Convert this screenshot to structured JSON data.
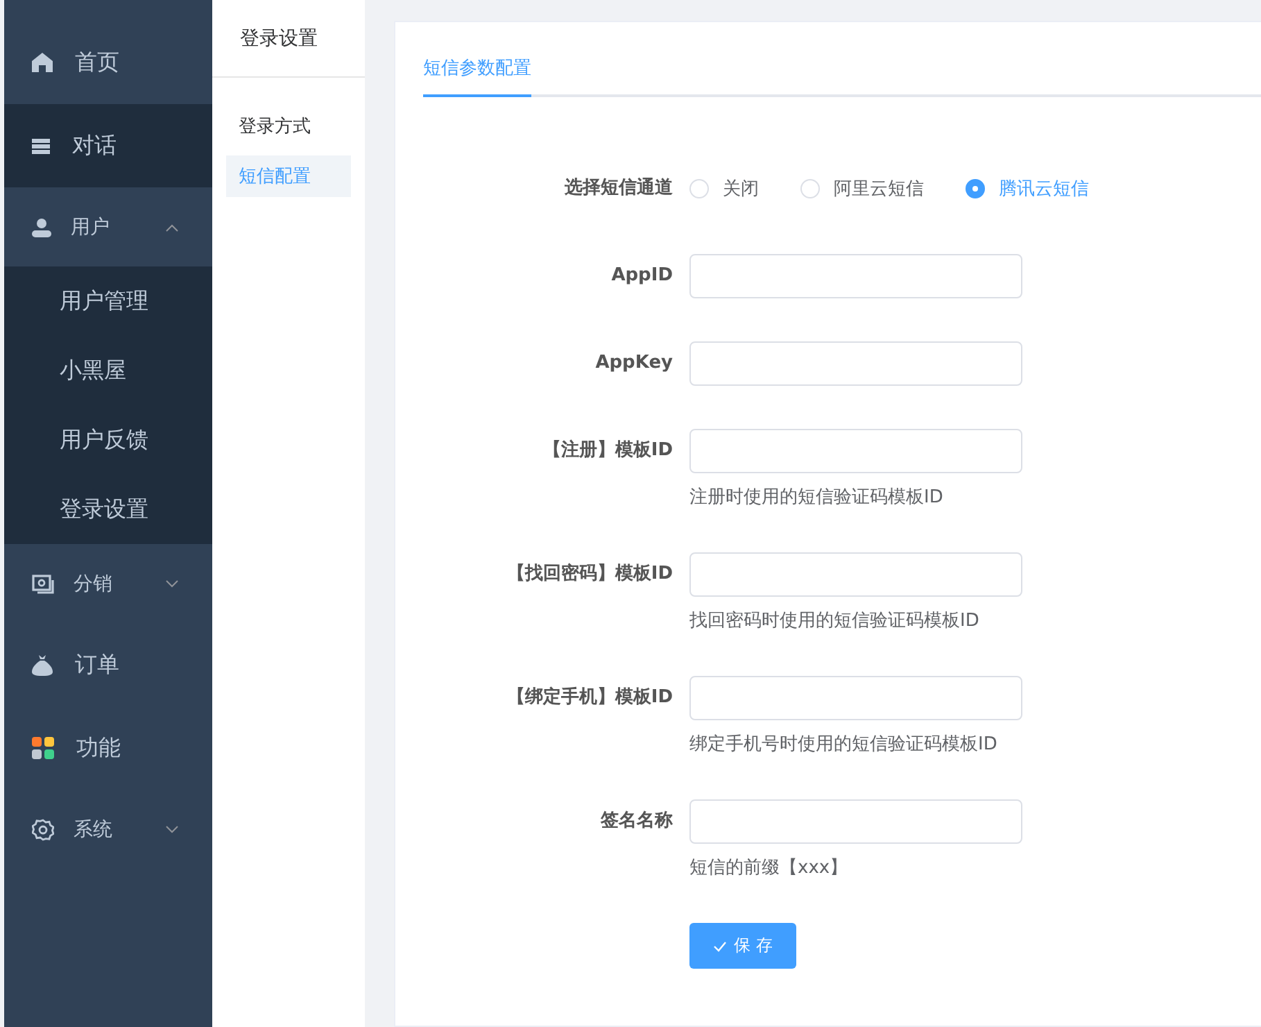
{
  "sidebar": {
    "items": [
      {
        "label": "首页",
        "hover": false
      },
      {
        "label": "对话",
        "hover": true
      },
      {
        "label": "用户",
        "hover": false,
        "expanded": true,
        "children": [
          {
            "label": "用户管理"
          },
          {
            "label": "小黑屋"
          },
          {
            "label": "用户反馈"
          },
          {
            "label": "登录设置"
          }
        ]
      },
      {
        "label": "分销",
        "hover": false,
        "expanded": false
      },
      {
        "label": "订单",
        "hover": false
      },
      {
        "label": "功能",
        "hover": false
      },
      {
        "label": "系统",
        "hover": false,
        "expanded": false
      }
    ]
  },
  "subnav": {
    "title": "登录设置",
    "items": [
      {
        "label": "登录方式",
        "selected": false
      },
      {
        "label": "短信配置",
        "selected": true
      }
    ]
  },
  "tabs": [
    {
      "label": "短信参数配置",
      "selected": true
    }
  ],
  "form": {
    "channel": {
      "label": "选择短信通道",
      "options": [
        {
          "label": "关闭",
          "selected": false
        },
        {
          "label": "阿里云短信",
          "selected": false
        },
        {
          "label": "腾讯云短信",
          "selected": true
        }
      ]
    },
    "fields": [
      {
        "label": "AppID"
      },
      {
        "label": "AppKey"
      },
      {
        "label": "【注册】模板ID",
        "hint": "注册时使用的短信验证码模板ID"
      },
      {
        "label": "【找回密码】模板ID",
        "hint": "找回密码时使用的短信验证码模板ID"
      },
      {
        "label": "【绑定手机】模板ID",
        "hint": "绑定手机号时使用的短信验证码模板ID"
      },
      {
        "label": "签名名称",
        "hint": "短信的前缀【xxx】"
      }
    ],
    "submit": "保 存"
  }
}
